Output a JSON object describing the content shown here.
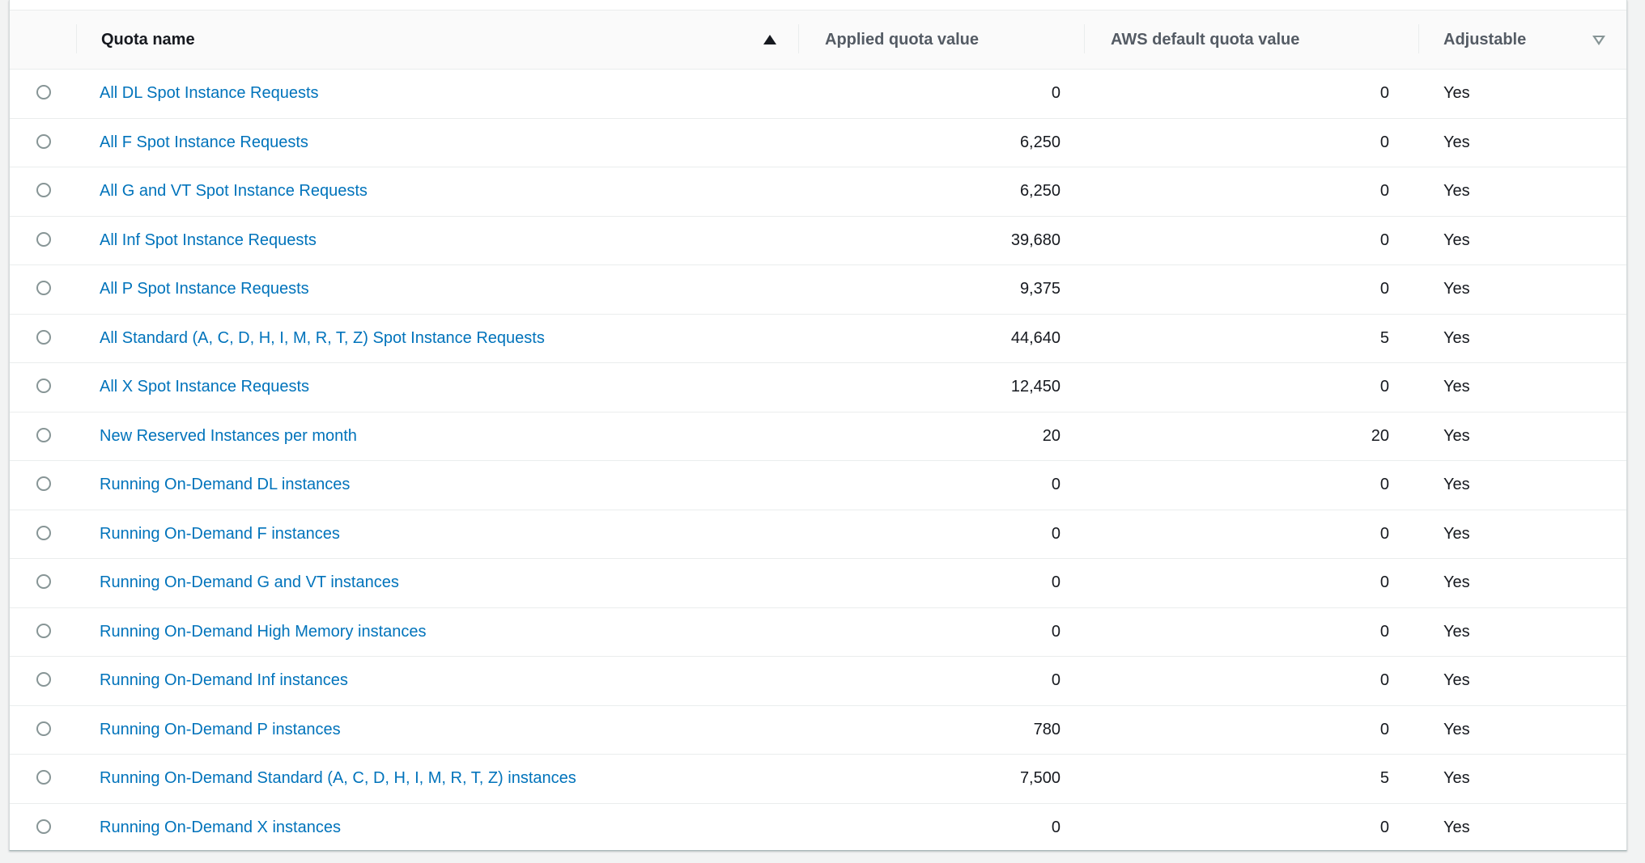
{
  "table": {
    "columns": {
      "quota_name": "Quota name",
      "applied_value": "Applied quota value",
      "default_value": "AWS default quota value",
      "adjustable": "Adjustable"
    },
    "sort": {
      "column": "Quota name",
      "direction": "ascending"
    },
    "rows": [
      {
        "name": "All DL Spot Instance Requests",
        "applied": "0",
        "default": "0",
        "adjustable": "Yes"
      },
      {
        "name": "All F Spot Instance Requests",
        "applied": "6,250",
        "default": "0",
        "adjustable": "Yes"
      },
      {
        "name": "All G and VT Spot Instance Requests",
        "applied": "6,250",
        "default": "0",
        "adjustable": "Yes"
      },
      {
        "name": "All Inf Spot Instance Requests",
        "applied": "39,680",
        "default": "0",
        "adjustable": "Yes"
      },
      {
        "name": "All P Spot Instance Requests",
        "applied": "9,375",
        "default": "0",
        "adjustable": "Yes"
      },
      {
        "name": "All Standard (A, C, D, H, I, M, R, T, Z) Spot Instance Requests",
        "applied": "44,640",
        "default": "5",
        "adjustable": "Yes"
      },
      {
        "name": "All X Spot Instance Requests",
        "applied": "12,450",
        "default": "0",
        "adjustable": "Yes"
      },
      {
        "name": "New Reserved Instances per month",
        "applied": "20",
        "default": "20",
        "adjustable": "Yes"
      },
      {
        "name": "Running On-Demand DL instances",
        "applied": "0",
        "default": "0",
        "adjustable": "Yes"
      },
      {
        "name": "Running On-Demand F instances",
        "applied": "0",
        "default": "0",
        "adjustable": "Yes"
      },
      {
        "name": "Running On-Demand G and VT instances",
        "applied": "0",
        "default": "0",
        "adjustable": "Yes"
      },
      {
        "name": "Running On-Demand High Memory instances",
        "applied": "0",
        "default": "0",
        "adjustable": "Yes"
      },
      {
        "name": "Running On-Demand Inf instances",
        "applied": "0",
        "default": "0",
        "adjustable": "Yes"
      },
      {
        "name": "Running On-Demand P instances",
        "applied": "780",
        "default": "0",
        "adjustable": "Yes"
      },
      {
        "name": "Running On-Demand Standard (A, C, D, H, I, M, R, T, Z) instances",
        "applied": "7,500",
        "default": "5",
        "adjustable": "Yes"
      },
      {
        "name": "Running On-Demand X instances",
        "applied": "0",
        "default": "0",
        "adjustable": "Yes"
      }
    ]
  },
  "colors": {
    "link": "#0073bb",
    "text": "#16191f",
    "header_text": "#545b64",
    "divider": "#eaeded",
    "radio_border": "#879596"
  },
  "icons": {
    "sort_ascending": "sort-ascending-icon",
    "sort_none": "sort-descending-inactive-icon",
    "row_select": "radio-button"
  }
}
